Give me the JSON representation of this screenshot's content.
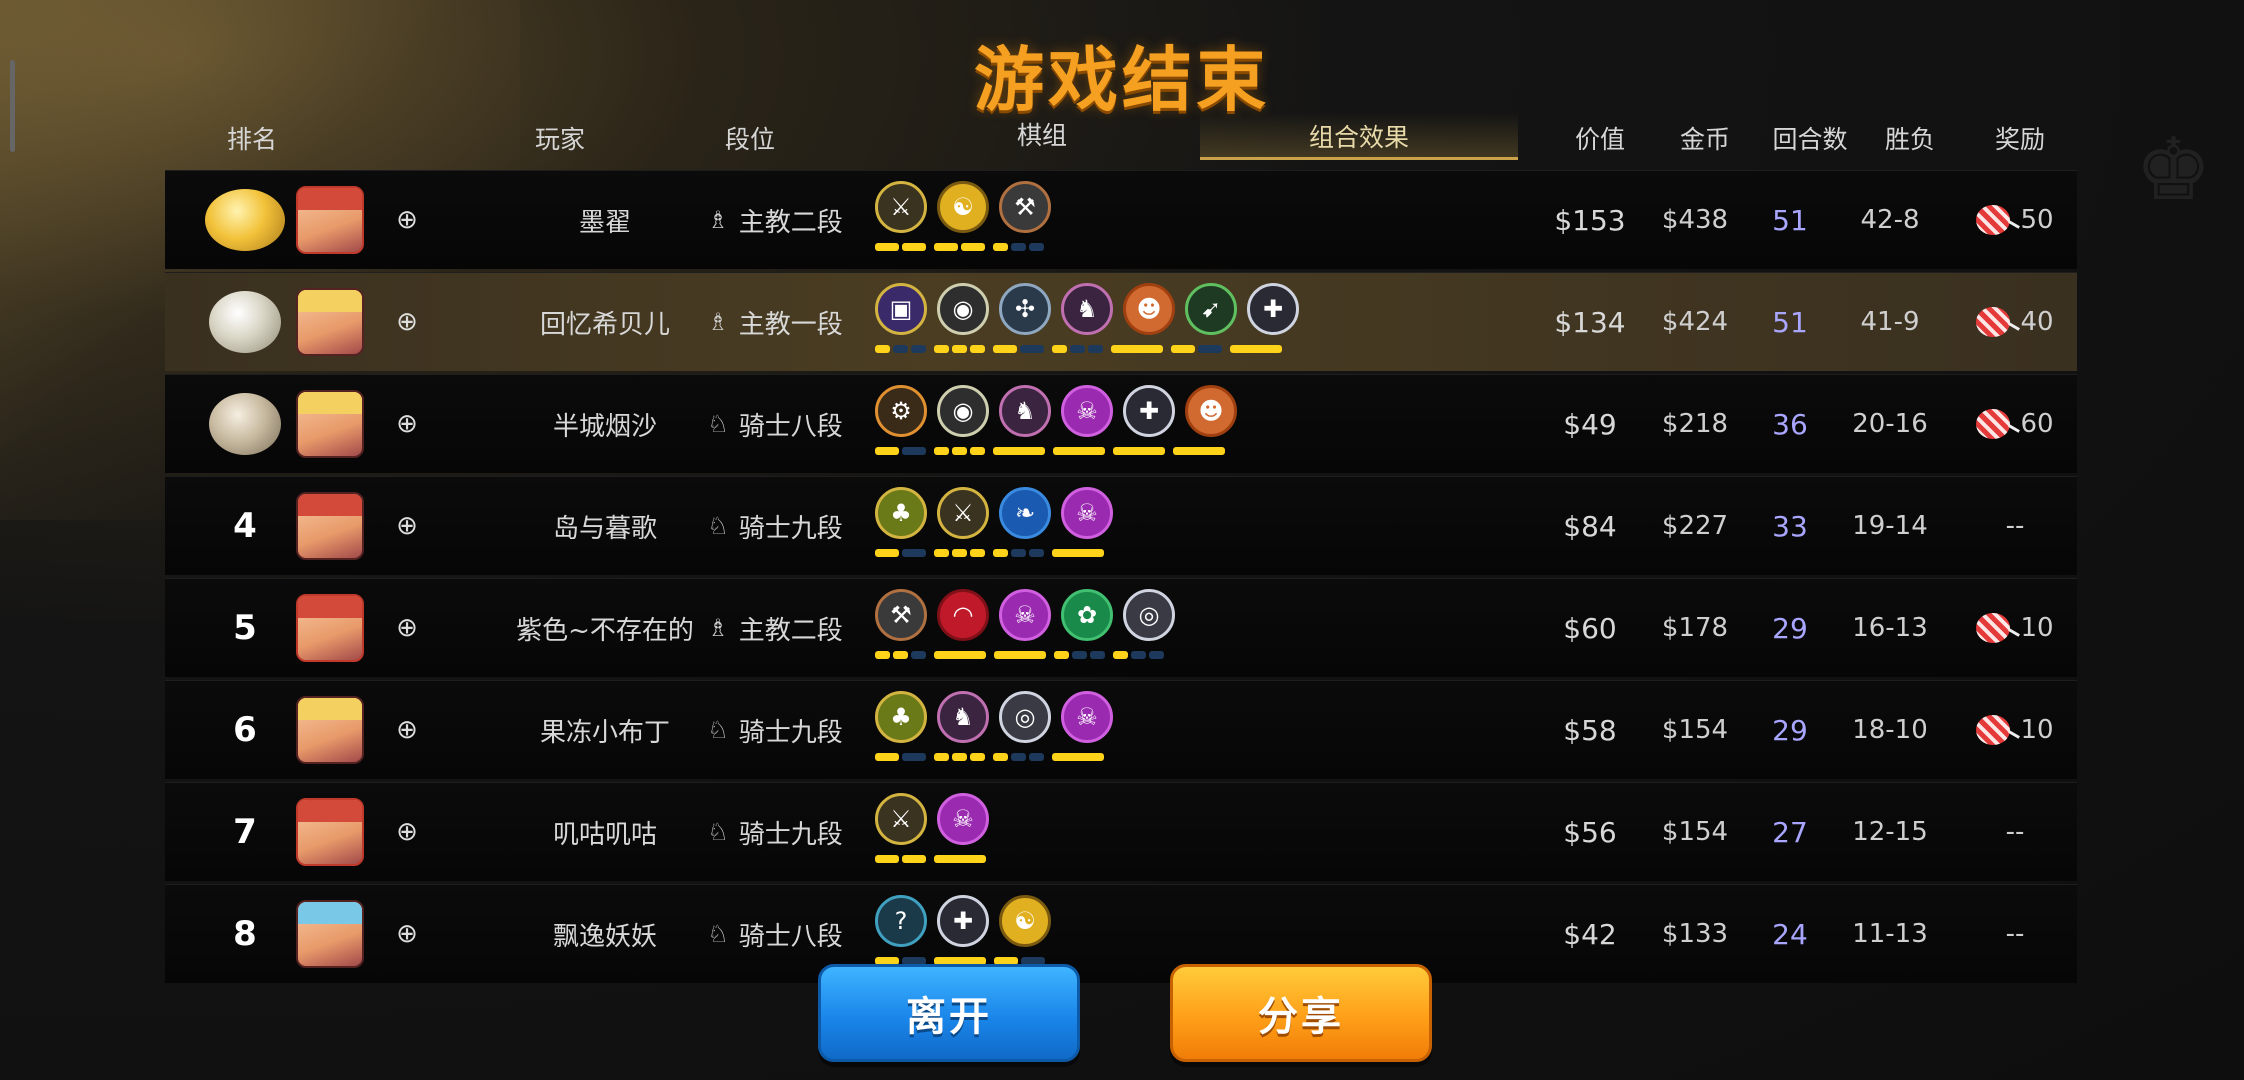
{
  "title": "游戏结束",
  "headers": {
    "rank": "排名",
    "player": "玩家",
    "tier": "段位",
    "board": "棋组",
    "synergy": "组合效果",
    "value": "价值",
    "gold": "金币",
    "rounds": "回合数",
    "winloss": "胜负",
    "reward": "奖励"
  },
  "rows": [
    {
      "rank": "",
      "medal": "gold",
      "name": "墨翟",
      "tier": "主教二段",
      "tier_icon": "bishop-icon",
      "value": "$153",
      "gold": "$438",
      "rounds": "51",
      "wl": "42-8",
      "reward": "50",
      "has_reward": true,
      "traits": [
        {
          "g": "⚔",
          "bg": "#3a3320",
          "b": "#d4b440"
        },
        {
          "g": "☯",
          "bg": "#e0b020",
          "b": "#7a5a10"
        },
        {
          "g": "⚒",
          "bg": "#3a3a3a",
          "b": "#b07040"
        }
      ],
      "bars": [
        [
          1,
          1
        ],
        [
          1,
          1
        ],
        [
          1,
          0,
          0
        ]
      ]
    },
    {
      "rank": "",
      "medal": "silver",
      "name": "回忆希贝儿",
      "tier": "主教一段",
      "tier_icon": "bishop-icon",
      "value": "$134",
      "gold": "$424",
      "rounds": "51",
      "wl": "41-9",
      "reward": "40",
      "has_reward": true,
      "traits": [
        {
          "g": "▣",
          "bg": "#3b2a6a",
          "b": "#d4b440"
        },
        {
          "g": "◉",
          "bg": "#2e2e2e",
          "b": "#cfcfb0"
        },
        {
          "g": "✣",
          "bg": "#2a3a4a",
          "b": "#8fa8c0"
        },
        {
          "g": "♞",
          "bg": "#3a2440",
          "b": "#c070b0"
        },
        {
          "g": "☻",
          "bg": "#d06a30",
          "b": "#a04010"
        },
        {
          "g": "➹",
          "bg": "#1e3a22",
          "b": "#60c060"
        },
        {
          "g": "✚",
          "bg": "#2a2a34",
          "b": "#cfd4e0"
        }
      ],
      "bars": [
        [
          1,
          0,
          0
        ],
        [
          1,
          1,
          1
        ],
        [
          1,
          0
        ],
        [
          1,
          0,
          0
        ],
        [
          1
        ],
        [
          1,
          0
        ],
        [
          1
        ]
      ]
    },
    {
      "rank": "",
      "medal": "bronze",
      "name": "半城烟沙",
      "tier": "骑士八段",
      "tier_icon": "knight-icon",
      "value": "$49",
      "gold": "$218",
      "rounds": "36",
      "wl": "20-16",
      "reward": "60",
      "has_reward": true,
      "traits": [
        {
          "g": "⚙",
          "bg": "#3a2a18",
          "b": "#e09030"
        },
        {
          "g": "◉",
          "bg": "#2e2e2e",
          "b": "#cfcfb0"
        },
        {
          "g": "♞",
          "bg": "#3a2440",
          "b": "#c070b0"
        },
        {
          "g": "☠",
          "bg": "#9a2ab0",
          "b": "#d060e0"
        },
        {
          "g": "✚",
          "bg": "#2a2a34",
          "b": "#cfd4e0"
        },
        {
          "g": "☻",
          "bg": "#d06a30",
          "b": "#a04010"
        }
      ],
      "bars": [
        [
          1,
          0
        ],
        [
          1,
          1,
          1
        ],
        [
          1
        ],
        [
          1
        ],
        [
          1
        ],
        [
          1
        ]
      ]
    },
    {
      "rank": "4",
      "medal": "",
      "name": "岛与暮歌",
      "tier": "骑士九段",
      "tier_icon": "knight-icon",
      "value": "$84",
      "gold": "$227",
      "rounds": "33",
      "wl": "19-14",
      "reward": "--",
      "has_reward": false,
      "traits": [
        {
          "g": "♣",
          "bg": "#6a7a18",
          "b": "#d4b440"
        },
        {
          "g": "⚔",
          "bg": "#3a3320",
          "b": "#d4b440"
        },
        {
          "g": "❧",
          "bg": "#1a5ab0",
          "b": "#3a8ae0"
        },
        {
          "g": "☠",
          "bg": "#9a2ab0",
          "b": "#d060e0"
        }
      ],
      "bars": [
        [
          1,
          0
        ],
        [
          1,
          1,
          1
        ],
        [
          1,
          0,
          0
        ],
        [
          1
        ]
      ]
    },
    {
      "rank": "5",
      "medal": "",
      "name": "紫色~不存在的",
      "tier": "主教二段",
      "tier_icon": "bishop-icon",
      "value": "$60",
      "gold": "$178",
      "rounds": "29",
      "wl": "16-13",
      "reward": "10",
      "has_reward": true,
      "traits": [
        {
          "g": "⚒",
          "bg": "#3a3a3a",
          "b": "#b07040"
        },
        {
          "g": "◠",
          "bg": "#c01a2a",
          "b": "#801018"
        },
        {
          "g": "☠",
          "bg": "#9a2ab0",
          "b": "#d060e0"
        },
        {
          "g": "✿",
          "bg": "#1a8a4a",
          "b": "#40c070"
        },
        {
          "g": "◎",
          "bg": "#3a3a44",
          "b": "#cfd4e0"
        }
      ],
      "bars": [
        [
          1,
          1,
          0
        ],
        [
          1
        ],
        [
          1
        ],
        [
          1,
          0,
          0
        ],
        [
          1,
          0,
          0
        ]
      ]
    },
    {
      "rank": "6",
      "medal": "",
      "name": "果冻小布丁",
      "tier": "骑士九段",
      "tier_icon": "knight-icon",
      "value": "$58",
      "gold": "$154",
      "rounds": "29",
      "wl": "18-10",
      "reward": "10",
      "has_reward": true,
      "traits": [
        {
          "g": "♣",
          "bg": "#6a7a18",
          "b": "#d4b440"
        },
        {
          "g": "♞",
          "bg": "#3a2440",
          "b": "#c070b0"
        },
        {
          "g": "◎",
          "bg": "#3a3a44",
          "b": "#cfd4e0"
        },
        {
          "g": "☠",
          "bg": "#9a2ab0",
          "b": "#d060e0"
        }
      ],
      "bars": [
        [
          1,
          0
        ],
        [
          1,
          1,
          1
        ],
        [
          1,
          0,
          0
        ],
        [
          1
        ]
      ]
    },
    {
      "rank": "7",
      "medal": "",
      "name": "叽咕叽咕",
      "tier": "骑士九段",
      "tier_icon": "knight-icon",
      "value": "$56",
      "gold": "$154",
      "rounds": "27",
      "wl": "12-15",
      "reward": "--",
      "has_reward": false,
      "traits": [
        {
          "g": "⚔",
          "bg": "#3a3320",
          "b": "#d4b440"
        },
        {
          "g": "☠",
          "bg": "#9a2ab0",
          "b": "#d060e0"
        }
      ],
      "bars": [
        [
          1,
          1
        ],
        [
          1
        ]
      ]
    },
    {
      "rank": "8",
      "medal": "",
      "name": "飘逸妖妖",
      "tier": "骑士八段",
      "tier_icon": "knight-icon",
      "value": "$42",
      "gold": "$133",
      "rounds": "24",
      "wl": "11-13",
      "reward": "--",
      "has_reward": false,
      "traits": [
        {
          "g": "?",
          "bg": "#1a3a4a",
          "b": "#40a0c0"
        },
        {
          "g": "✚",
          "bg": "#2a2a34",
          "b": "#cfd4e0"
        },
        {
          "g": "☯",
          "bg": "#e0b020",
          "b": "#7a5a10"
        }
      ],
      "bars": [
        [
          1,
          0
        ],
        [
          1
        ],
        [
          1,
          0
        ]
      ]
    }
  ],
  "buttons": {
    "leave": "离开",
    "share": "分享"
  },
  "colors": {
    "title": "#f5a020",
    "rounds": "#a9a6ff",
    "leave_button": "#1a86ea",
    "share_button": "#ff9f18",
    "bar_on": "#ffd31a",
    "bar_off": "#1d3a5c"
  }
}
